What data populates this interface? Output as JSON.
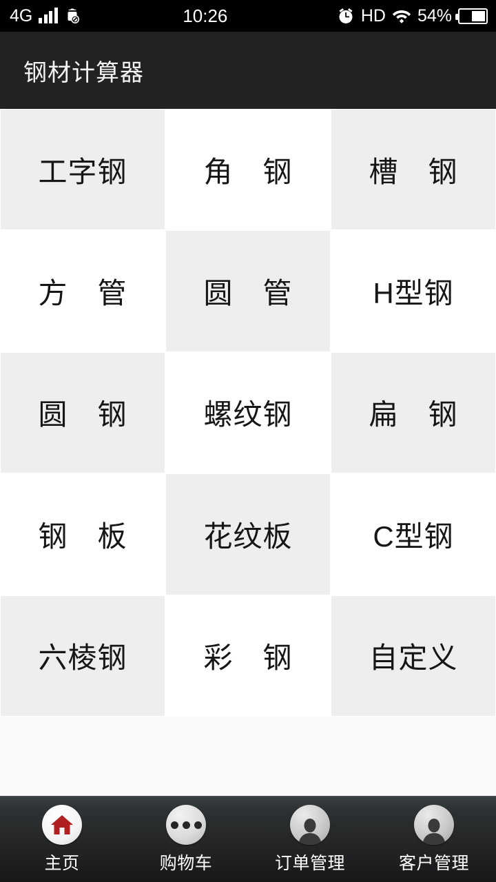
{
  "status_bar": {
    "network_label": "4G",
    "signal_icon": "signal-bars-icon",
    "android_blocked_icon": "android-blocked-icon",
    "clock": "10:26",
    "alarm_icon": "alarm-clock-icon",
    "hd_label": "HD",
    "wifi_icon": "wifi-icon",
    "battery_percent": "54%",
    "battery_icon": "battery-icon",
    "background_color": "#000000",
    "text_color": "#ffffff"
  },
  "title_bar": {
    "title": "钢材计算器",
    "background_color": "#222222",
    "text_color": "#f2f2f2"
  },
  "grid": {
    "columns": 3,
    "rows": 5,
    "shade_color": "#eeeeee",
    "plain_color": "#ffffff",
    "text_color": "#161616",
    "items": [
      {
        "label": "工字钢",
        "shade": "a"
      },
      {
        "label": "角　钢",
        "shade": "b"
      },
      {
        "label": "槽　钢",
        "shade": "a"
      },
      {
        "label": "方　管",
        "shade": "b"
      },
      {
        "label": "圆　管",
        "shade": "a"
      },
      {
        "label": "H型钢",
        "shade": "b"
      },
      {
        "label": "圆　钢",
        "shade": "a"
      },
      {
        "label": "螺纹钢",
        "shade": "b"
      },
      {
        "label": "扁　钢",
        "shade": "a"
      },
      {
        "label": "钢　板",
        "shade": "b"
      },
      {
        "label": "花纹板",
        "shade": "a"
      },
      {
        "label": "C型钢",
        "shade": "b"
      },
      {
        "label": "六棱钢",
        "shade": "a"
      },
      {
        "label": "彩　钢",
        "shade": "b"
      },
      {
        "label": "自定义",
        "shade": "a"
      }
    ]
  },
  "bottom_nav": {
    "background_top_color": "#3a4042",
    "background_bottom_color": "#161617",
    "label_color": "#fdfdfd",
    "items": [
      {
        "label": "主页",
        "icon": "home-icon",
        "icon_color": "#b02020"
      },
      {
        "label": "购物车",
        "icon": "three-dots-icon",
        "icon_color": "#262626"
      },
      {
        "label": "订单管理",
        "icon": "person-icon",
        "icon_color": "#3a3a3a"
      },
      {
        "label": "客户管理",
        "icon": "person-icon",
        "icon_color": "#3a3a3a"
      }
    ]
  }
}
